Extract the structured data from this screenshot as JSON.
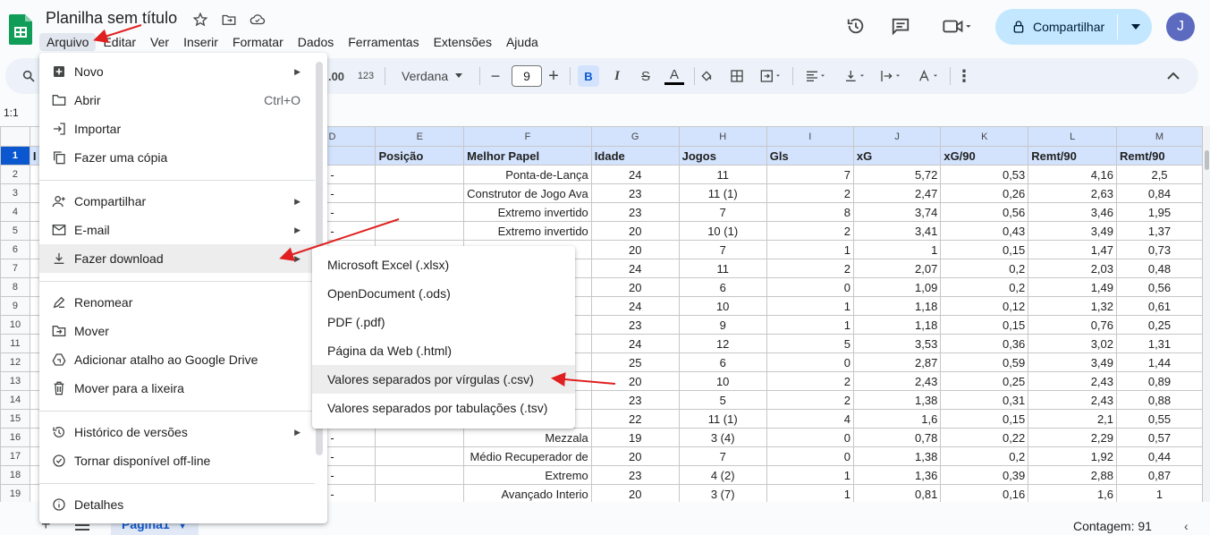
{
  "header": {
    "doc_title": "Planilha sem título",
    "menus": [
      "Arquivo",
      "Editar",
      "Ver",
      "Inserir",
      "Formatar",
      "Dados",
      "Ferramentas",
      "Extensões",
      "Ajuda"
    ],
    "share_label": "Compartilhar",
    "avatar_initial": "J"
  },
  "toolbar": {
    "num_format_00": ".00",
    "num_format_123": "123",
    "font": "Verdana",
    "font_size": "9",
    "bold": "B",
    "italic": "I",
    "strike": "S",
    "text_color": "A"
  },
  "namebox": "1:1",
  "grid": {
    "columns": [
      "D",
      "E",
      "F",
      "G",
      "H",
      "I",
      "J",
      "K",
      "L",
      "M"
    ],
    "header_row": [
      "be",
      "Posição",
      "Melhor Papel",
      "Idade",
      "Jogos",
      "Gls",
      "xG",
      "xG/90",
      "Remt/90",
      "Remt/90"
    ],
    "first_col_header_fragment": "I",
    "rows": [
      {
        "n": "2",
        "d": "-",
        "e": "",
        "f": "Ponta-de-Lança",
        "g": "24",
        "h": "11",
        "i": "7",
        "j": "5,72",
        "k": "0,53",
        "l": "4,16",
        "m": "2,5"
      },
      {
        "n": "3",
        "d": "-",
        "e": "",
        "f": "Construtor de Jogo Ava",
        "g": "23",
        "h": "11 (1)",
        "i": "2",
        "j": "2,47",
        "k": "0,26",
        "l": "2,63",
        "m": "0,84"
      },
      {
        "n": "4",
        "d": "-",
        "e": "",
        "f": "Extremo invertido",
        "g": "23",
        "h": "7",
        "i": "8",
        "j": "3,74",
        "k": "0,56",
        "l": "3,46",
        "m": "1,95"
      },
      {
        "n": "5",
        "d": "-",
        "e": "",
        "f": "Extremo invertido",
        "g": "20",
        "h": "10 (1)",
        "i": "2",
        "j": "3,41",
        "k": "0,43",
        "l": "3,49",
        "m": "1,37"
      },
      {
        "n": "6",
        "d": "",
        "e": "",
        "f": "",
        "g": "20",
        "h": "7",
        "i": "1",
        "j": "1",
        "k": "0,15",
        "l": "1,47",
        "m": "0,73"
      },
      {
        "n": "7",
        "d": "",
        "e": "",
        "f": "",
        "g": "24",
        "h": "11",
        "i": "2",
        "j": "2,07",
        "k": "0,2",
        "l": "2,03",
        "m": "0,48"
      },
      {
        "n": "8",
        "d": "",
        "e": "",
        "f": "",
        "g": "20",
        "h": "6",
        "i": "0",
        "j": "1,09",
        "k": "0,2",
        "l": "1,49",
        "m": "0,56"
      },
      {
        "n": "9",
        "d": "",
        "e": "",
        "f": "",
        "g": "24",
        "h": "10",
        "i": "1",
        "j": "1,18",
        "k": "0,12",
        "l": "1,32",
        "m": "0,61"
      },
      {
        "n": "10",
        "d": "",
        "e": "",
        "f": "",
        "g": "23",
        "h": "9",
        "i": "1",
        "j": "1,18",
        "k": "0,15",
        "l": "0,76",
        "m": "0,25"
      },
      {
        "n": "11",
        "d": "",
        "e": "",
        "f": "",
        "g": "24",
        "h": "12",
        "i": "5",
        "j": "3,53",
        "k": "0,36",
        "l": "3,02",
        "m": "1,31"
      },
      {
        "n": "12",
        "d": "",
        "e": "",
        "f": "",
        "g": "25",
        "h": "6",
        "i": "0",
        "j": "2,87",
        "k": "0,59",
        "l": "3,49",
        "m": "1,44"
      },
      {
        "n": "13",
        "d": "",
        "e": "",
        "f": "",
        "g": "20",
        "h": "10",
        "i": "2",
        "j": "2,43",
        "k": "0,25",
        "l": "2,43",
        "m": "0,89"
      },
      {
        "n": "14",
        "d": "",
        "e": "",
        "f": "",
        "g": "23",
        "h": "5",
        "i": "2",
        "j": "1,38",
        "k": "0,31",
        "l": "2,43",
        "m": "0,88"
      },
      {
        "n": "15",
        "d": "",
        "e": "",
        "f": "",
        "g": "22",
        "h": "11 (1)",
        "i": "4",
        "j": "1,6",
        "k": "0,15",
        "l": "2,1",
        "m": "0,55"
      },
      {
        "n": "16",
        "d": "-",
        "e": "",
        "f": "Mezzala",
        "g": "19",
        "h": "3 (4)",
        "i": "0",
        "j": "0,78",
        "k": "0,22",
        "l": "2,29",
        "m": "0,57"
      },
      {
        "n": "17",
        "d": "-",
        "e": "",
        "f": "Médio Recuperador de",
        "g": "20",
        "h": "7",
        "i": "0",
        "j": "1,38",
        "k": "0,2",
        "l": "1,92",
        "m": "0,44"
      },
      {
        "n": "18",
        "d": "-",
        "e": "",
        "f": "Extremo",
        "g": "23",
        "h": "4 (2)",
        "i": "1",
        "j": "1,36",
        "k": "0,39",
        "l": "2,88",
        "m": "0,87"
      },
      {
        "n": "19",
        "d": "-",
        "e": "",
        "f": "Avançado Interio",
        "g": "20",
        "h": "3 (7)",
        "i": "1",
        "j": "0,81",
        "k": "0,16",
        "l": "1,6",
        "m": "1"
      }
    ]
  },
  "file_menu": {
    "items": [
      {
        "label": "Novo",
        "icon": "plus-box-icon",
        "arrow": true
      },
      {
        "label": "Abrir",
        "icon": "folder-icon",
        "shortcut": "Ctrl+O"
      },
      {
        "label": "Importar",
        "icon": "import-icon"
      },
      {
        "label": "Fazer uma cópia",
        "icon": "copy-icon"
      },
      {
        "label": "Compartilhar",
        "icon": "person-add-icon",
        "arrow": true
      },
      {
        "label": "E-mail",
        "icon": "email-icon",
        "arrow": true
      },
      {
        "label": "Fazer download",
        "icon": "download-icon",
        "arrow": true
      },
      {
        "label": "Renomear",
        "icon": "rename-icon"
      },
      {
        "label": "Mover",
        "icon": "move-folder-icon"
      },
      {
        "label": "Adicionar atalho ao Google Drive",
        "icon": "drive-shortcut-icon"
      },
      {
        "label": "Mover para a lixeira",
        "icon": "trash-icon"
      },
      {
        "label": "Histórico de versões",
        "icon": "history-icon",
        "arrow": true
      },
      {
        "label": "Tornar disponível off-line",
        "icon": "offline-icon"
      },
      {
        "label": "Detalhes",
        "icon": "info-icon"
      }
    ]
  },
  "download_submenu": {
    "items": [
      "Microsoft Excel (.xlsx)",
      "OpenDocument (.ods)",
      "PDF (.pdf)",
      "Página da Web (.html)",
      "Valores separados por vírgulas (.csv)",
      "Valores separados por tabulações (.tsv)"
    ]
  },
  "bottom": {
    "sheet_tab": "Página1",
    "count": "Contagem: 91"
  },
  "colors": {
    "accent": "#0b57d0",
    "share_bg": "#c2e7ff",
    "annotation_arrow": "#e02020"
  }
}
